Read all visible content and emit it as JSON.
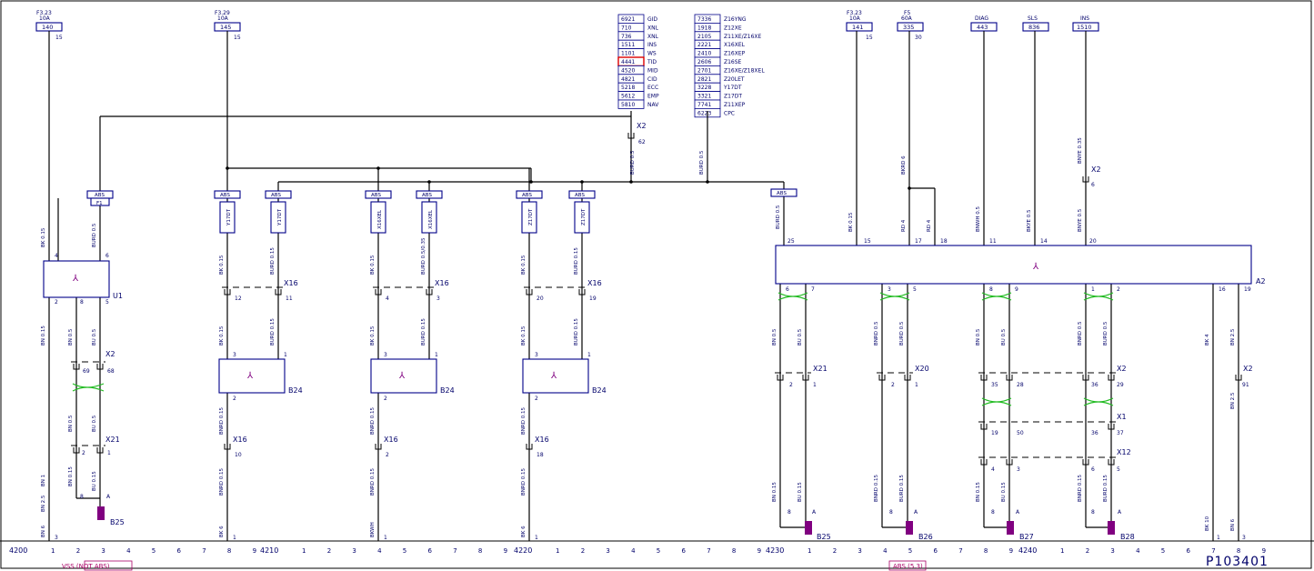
{
  "diagram_id": "P103401",
  "fuses": [
    {
      "id": "f1",
      "rating": "F3.23",
      "amps": "10A",
      "box": "140",
      "pin": "15"
    },
    {
      "id": "f2",
      "rating": "F3.29",
      "amps": "10A",
      "box": "145",
      "pin": "15"
    },
    {
      "id": "f3",
      "rating": "F3.23",
      "amps": "10A",
      "box": "141",
      "pin": "15"
    },
    {
      "id": "f4",
      "rating": "F5",
      "amps": "60A",
      "box": "335",
      "pin": "30"
    }
  ],
  "feeds": [
    {
      "id": "diag",
      "label": "DIAG",
      "box": "443"
    },
    {
      "id": "sls",
      "label": "SLS",
      "box": "836"
    },
    {
      "id": "ins",
      "label": "INS",
      "box": "1510"
    }
  ],
  "xref_left": [
    {
      "num": "6921",
      "code": "GID"
    },
    {
      "num": "710",
      "code": "XNL"
    },
    {
      "num": "736",
      "code": "XNL"
    },
    {
      "num": "1511",
      "code": "INS"
    },
    {
      "num": "1101",
      "code": "WS"
    },
    {
      "num": "4441",
      "code": "TID"
    },
    {
      "num": "4520",
      "code": "MID"
    },
    {
      "num": "4821",
      "code": "CID"
    },
    {
      "num": "5218",
      "code": "ECC"
    },
    {
      "num": "5612",
      "code": "EMP"
    },
    {
      "num": "5810",
      "code": "NAV"
    }
  ],
  "xref_right": [
    {
      "num": "7336",
      "code": "Z16YNG"
    },
    {
      "num": "1918",
      "code": "Z12XE"
    },
    {
      "num": "2105",
      "code": "Z11XE/Z16XE"
    },
    {
      "num": "2221",
      "code": "X16XEL"
    },
    {
      "num": "2410",
      "code": "Z16XEP"
    },
    {
      "num": "2606",
      "code": "Z16SE"
    },
    {
      "num": "2701",
      "code": "Z16XE/Z18XEL"
    },
    {
      "num": "2821",
      "code": "Z20LET"
    },
    {
      "num": "3228",
      "code": "Y17DT"
    },
    {
      "num": "3321",
      "code": "Z17DT"
    },
    {
      "num": "7741",
      "code": "Z11XEP"
    },
    {
      "num": "6223",
      "code": "CPC"
    }
  ],
  "tags": {
    "abs": "ABS",
    "f1": "F1",
    "y17dt": "Y17DT",
    "x16xel": "X16XEL",
    "z17dt": "Z17DT"
  },
  "connectors": {
    "x2": "X2",
    "x16": "X16",
    "x21": "X21",
    "x20": "X20",
    "x1": "X1",
    "x12": "X12"
  },
  "components": {
    "u1": "U1",
    "a2": "A2",
    "b24": "B24",
    "b25": "B25",
    "b26": "B26",
    "b27": "B27",
    "b28": "B28"
  },
  "wires": {
    "bk015": "BK 0.15",
    "bk035": "BK 0.35",
    "bu015": "BU 0.15",
    "bu05": "BU 0.5",
    "bn05": "BN 0.5",
    "bn015": "BN 0.15",
    "bn1": "BN 1",
    "bn25": "BN 2.5",
    "bn6": "BN 6",
    "burd05": "BURD 0.5",
    "burd015": "BURD 0.15",
    "burd035": "BURD 0.35",
    "bnrd05": "BNRD 0.5",
    "bnrd015": "BNRD 0.15",
    "bk6": "BK 6",
    "bk10": "BK 10",
    "bkrd6": "BKRD 6",
    "bnye035": "BNYE 0.35",
    "bkye05": "BKYE 0.5",
    "bnwh05": "BNWH 0.5",
    "bkye035": "BKYE 0.5/0.35",
    "burd05035": "BURD 0.5/0.35",
    "bnye05": "BNYE 0.5",
    "bkrd": "BKRD",
    "rd4": "RD 4",
    "bk4": "BK 4",
    "bkwh": "BKWH"
  },
  "pins": {
    "p1": "1",
    "p2": "2",
    "p3": "3",
    "p4": "4",
    "p5": "5",
    "p6": "6",
    "p7": "7",
    "p8": "8",
    "p9": "9",
    "p10": "10",
    "p11": "11",
    "p12": "12",
    "p14": "14",
    "p15": "15",
    "p16": "16",
    "p17": "17",
    "p18": "18",
    "p19": "19",
    "p20": "20",
    "p25": "25",
    "p28": "28",
    "p29": "29",
    "p35": "35",
    "p36": "36",
    "p37": "37",
    "p50": "50",
    "p62": "62",
    "p68": "68",
    "p69": "69",
    "p91": "91",
    "pA": "A"
  },
  "grid": [
    {
      "num": "4200",
      "marks": [
        "1",
        "2",
        "3",
        "4",
        "5",
        "6",
        "7",
        "8",
        "9"
      ]
    },
    {
      "num": "4210",
      "marks": [
        "1",
        "2",
        "3",
        "4",
        "5",
        "6",
        "7",
        "8",
        "9"
      ]
    },
    {
      "num": "4220",
      "marks": [
        "1",
        "2",
        "3",
        "4",
        "5",
        "6",
        "7",
        "8",
        "9"
      ]
    },
    {
      "num": "4230",
      "marks": [
        "1",
        "2",
        "3",
        "4",
        "5",
        "6",
        "7",
        "8",
        "9"
      ]
    },
    {
      "num": "4240",
      "marks": [
        "1",
        "2",
        "3",
        "4",
        "5",
        "6",
        "7",
        "8",
        "9"
      ]
    }
  ],
  "footer": {
    "left": "VSS (NOT ABS)",
    "right": "ABS (5.3)"
  },
  "colors": {
    "line": "#000000",
    "text": "#00006a",
    "sensor": "#800080",
    "twist": "#22bb22",
    "highlight": "#dd0000",
    "footer": "#aa0066"
  }
}
